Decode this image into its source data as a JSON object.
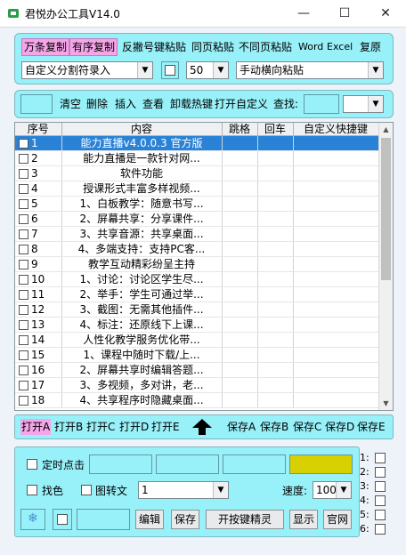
{
  "app": {
    "title": "君悦办公工具V14.0"
  },
  "window": {
    "minimize": "—",
    "maximize": "☐",
    "close": "✕"
  },
  "toolbar1": {
    "copy_multi": "万条复制",
    "copy_ordered": "有序复制",
    "reverse_paste": "反撇号键粘贴",
    "same_page_paste": "同页粘贴",
    "diff_page_paste": "不同页粘贴",
    "word": "Word",
    "excel": "Excel",
    "restore": "复原",
    "separator_select": "自定义分割符录入",
    "count_select": "50",
    "paste_mode_select": "手动横向粘贴"
  },
  "toolbar2": {
    "clear": "清空",
    "delete": "删除",
    "insert": "插入",
    "view": "查看",
    "unload_hotkey": "卸载热键",
    "open_custom": "打开自定义",
    "search_label": "查找:"
  },
  "table": {
    "headers": [
      "序号",
      "内容",
      "跳格",
      "回车",
      "自定义快捷键"
    ],
    "rows": [
      {
        "num": "1",
        "content": "能力直播v4.0.0.3 官方版",
        "selected": true
      },
      {
        "num": "2",
        "content": "能力直播是一款针对网..."
      },
      {
        "num": "3",
        "content": "软件功能"
      },
      {
        "num": "4",
        "content": "授课形式丰富多样视频..."
      },
      {
        "num": "5",
        "content": "1、白板教学：随意书写..."
      },
      {
        "num": "6",
        "content": "2、屏幕共享：分享课件..."
      },
      {
        "num": "7",
        "content": "3、共享音源：共享桌面..."
      },
      {
        "num": "8",
        "content": "4、多端支持：支持PC客..."
      },
      {
        "num": "9",
        "content": "教学互动精彩纷呈主持"
      },
      {
        "num": "10",
        "content": "1、讨论：讨论区学生尽..."
      },
      {
        "num": "11",
        "content": "2、举手：学生可通过举..."
      },
      {
        "num": "12",
        "content": "3、截图：无需其他插件..."
      },
      {
        "num": "13",
        "content": "4、标注：还原线下上课..."
      },
      {
        "num": "14",
        "content": "人性化教学服务优化带..."
      },
      {
        "num": "15",
        "content": "1、课程中随时下载/上..."
      },
      {
        "num": "16",
        "content": "2、屏幕共享时编辑答题..."
      },
      {
        "num": "17",
        "content": "3、多视频，多对讲，老..."
      },
      {
        "num": "18",
        "content": "4、共享程序时隐藏桌面..."
      }
    ]
  },
  "filebar": {
    "open_a": "打开A",
    "open_b": "打开B",
    "open_c": "打开C",
    "open_d": "打开D",
    "open_e": "打开E",
    "save_a": "保存A",
    "save_b": "保存B",
    "save_c": "保存C",
    "save_d": "保存D",
    "save_e": "保存E"
  },
  "bottom": {
    "timer_click": "定时点击",
    "find_color": "找色",
    "image_to_text": "图转文",
    "mode_select": "1",
    "speed_label": "速度:",
    "speed_value": "100",
    "edit": "编辑",
    "save": "保存",
    "open_hotkey_wizard": "开按键精灵",
    "show": "显示",
    "official_site": "官网",
    "side_checks": [
      "1:",
      "2:",
      "3:",
      "4:",
      "5:",
      "6:"
    ]
  },
  "colors": {
    "panel": "#98f0f8",
    "pink": "#f5a5e8",
    "selected_row": "#2a82d6",
    "yellow_box": "#d8d000"
  }
}
